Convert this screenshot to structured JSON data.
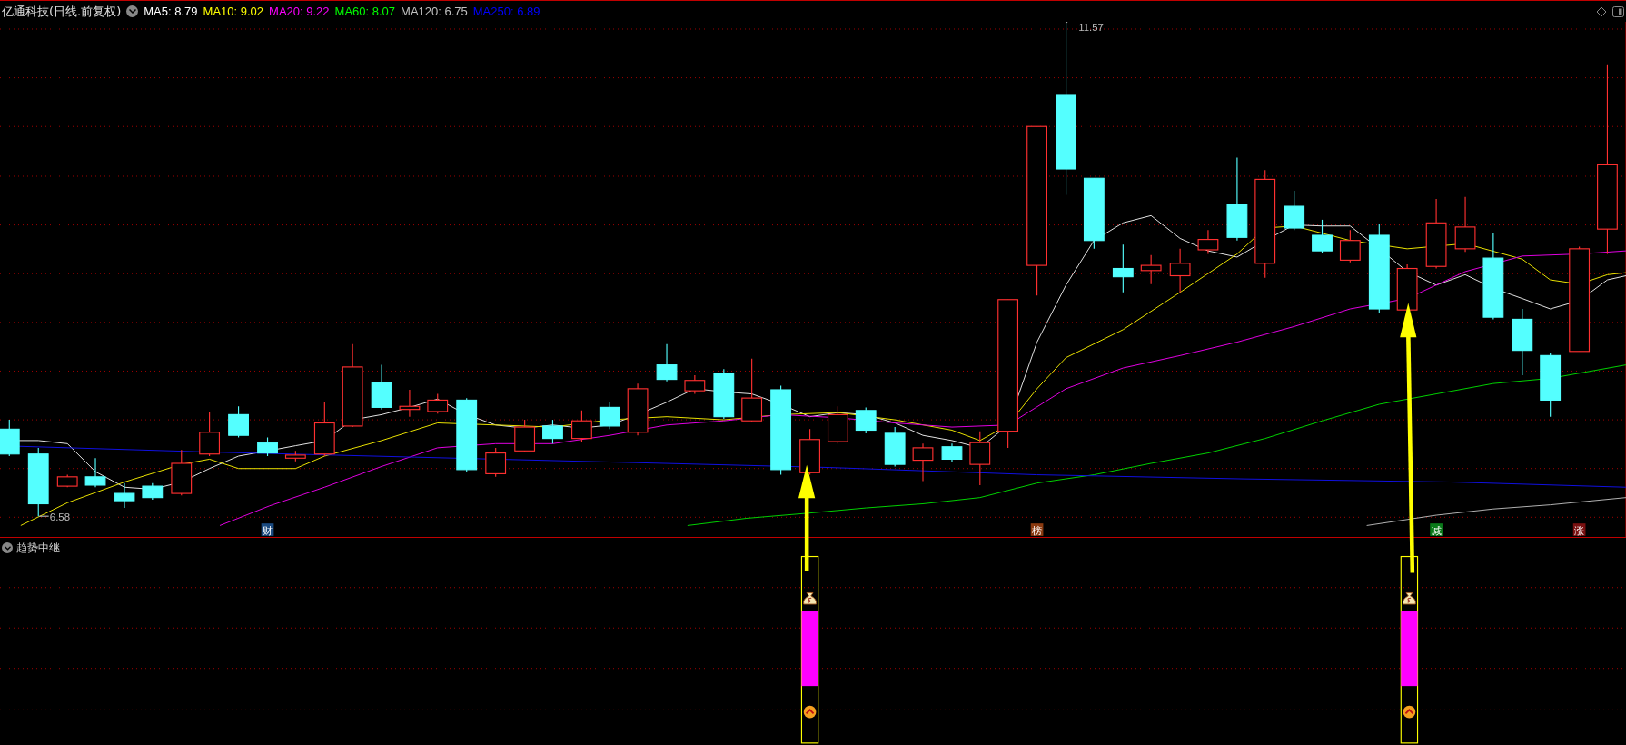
{
  "header": {
    "title": "亿通科技(日线.前复权)",
    "ma_values": [
      {
        "label": "MA5: 8.79",
        "color": "#ffffff"
      },
      {
        "label": "MA10: 9.02",
        "color": "#ffff00"
      },
      {
        "label": "MA20: 9.22",
        "color": "#ff00ff"
      },
      {
        "label": "MA60: 8.07",
        "color": "#00ff00"
      },
      {
        "label": "MA120: 6.75",
        "color": "#c0c0c0"
      },
      {
        "label": "MA250: 6.89",
        "color": "#0000ff"
      }
    ]
  },
  "price_chart": {
    "high_label": "11.57",
    "low_label": "6.58",
    "event_markers": [
      {
        "label": "财",
        "color": "#1a4a80"
      },
      {
        "label": "榜",
        "color": "#8a3a10"
      },
      {
        "label": "减",
        "color": "#0a7a1a"
      },
      {
        "label": "涨",
        "color": "#7a1010"
      }
    ]
  },
  "indicator_panel": {
    "title": "趋势中继"
  }
}
